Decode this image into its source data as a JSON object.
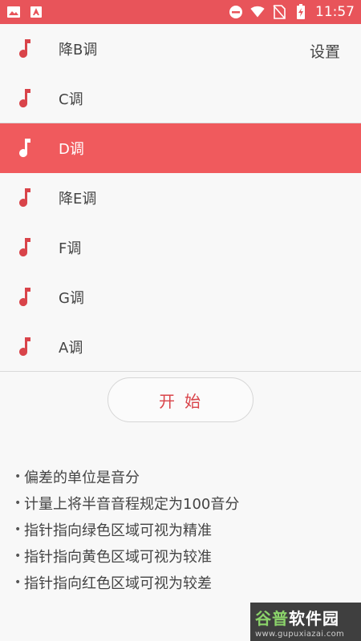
{
  "status_bar": {
    "time": "11:57",
    "background": "#e8545a",
    "left_icons": [
      "image-icon",
      "app-notification-icon"
    ],
    "right_icons": [
      "do-not-disturb-icon",
      "wifi-icon",
      "no-sim-icon",
      "battery-charging-icon"
    ]
  },
  "header": {
    "settings_label": "设置"
  },
  "keys": {
    "selected_color": "#f05a5d",
    "items": [
      {
        "label": "降B调"
      },
      {
        "label": "C调"
      },
      {
        "label": "D调"
      },
      {
        "label": "降E调"
      },
      {
        "label": "F调"
      },
      {
        "label": "G调"
      },
      {
        "label": "A调"
      }
    ],
    "selected_label": "D调"
  },
  "start_button": {
    "label": "开始"
  },
  "info": {
    "items": [
      "偏差的单位是音分",
      "计量上将半音音程规定为100音分",
      "指针指向绿色区域可视为精准",
      "指针指向黄色区域可视为较准",
      "指针指向红色区域可视为较差"
    ]
  },
  "watermark": {
    "title_part1": "谷普",
    "title_part2": "软件园",
    "url": "www.gupuxiazai.com"
  }
}
